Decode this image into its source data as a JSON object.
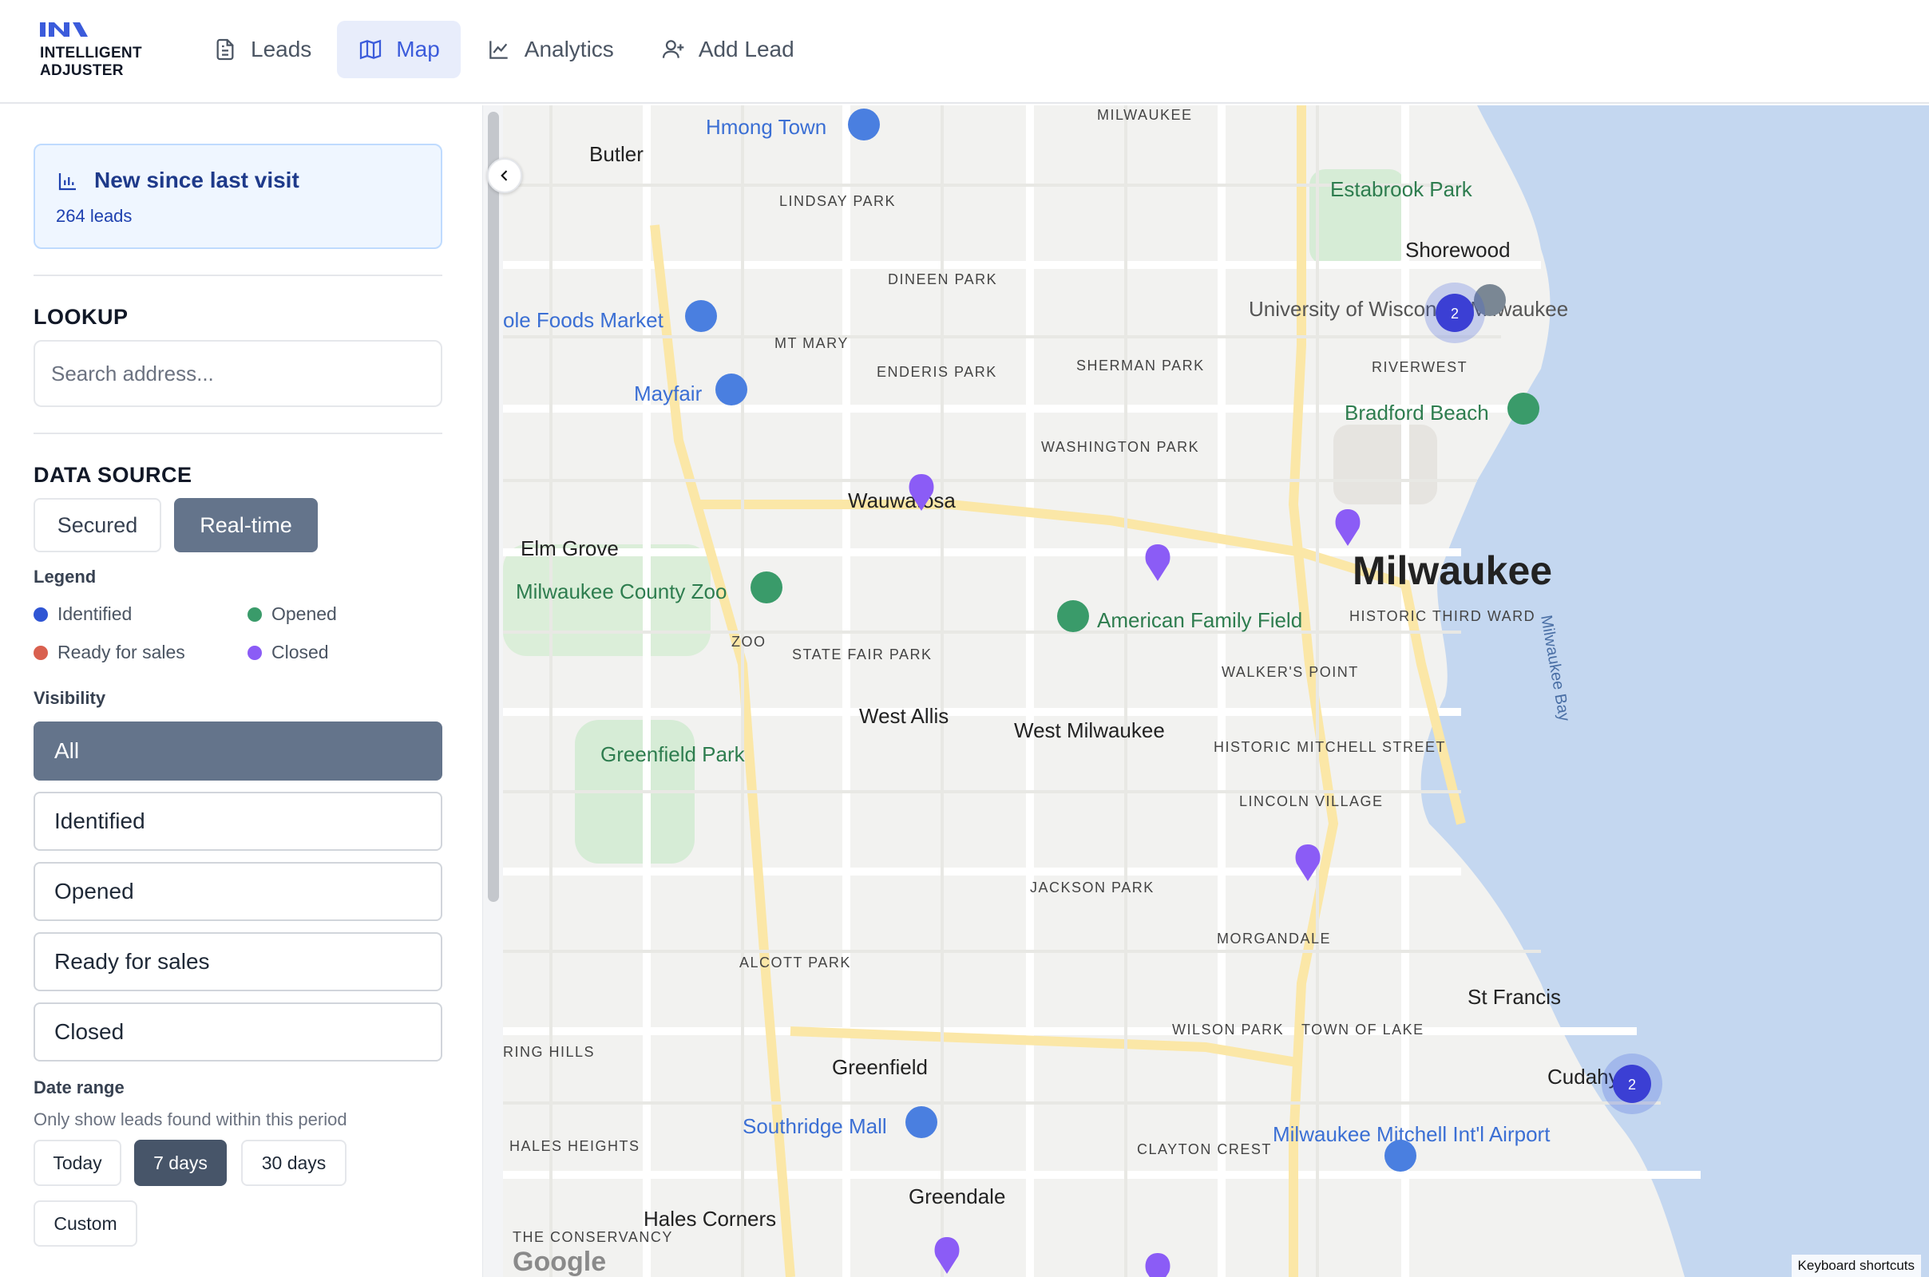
{
  "brand": {
    "line1": "INTELLIGENT",
    "line2": "ADJUSTER",
    "accent": "#3b5bdb"
  },
  "nav": [
    {
      "label": "Leads",
      "icon": "document-icon",
      "active": false
    },
    {
      "label": "Map",
      "icon": "map-icon",
      "active": true
    },
    {
      "label": "Analytics",
      "icon": "chart-icon",
      "active": false
    },
    {
      "label": "Add Lead",
      "icon": "user-plus-icon",
      "active": false
    }
  ],
  "new_card": {
    "title": "New since last visit",
    "subtitle": "264 leads"
  },
  "lookup": {
    "heading": "LOOKUP",
    "placeholder": "Search address..."
  },
  "data_source": {
    "heading": "DATA SOURCE",
    "options": [
      "Secured",
      "Real-time"
    ],
    "selected": "Real-time"
  },
  "legend": {
    "heading": "Legend",
    "items": [
      {
        "label": "Identified",
        "color": "#2f55d4"
      },
      {
        "label": "Opened",
        "color": "#3a9b6a"
      },
      {
        "label": "Ready for sales",
        "color": "#d9604f"
      },
      {
        "label": "Closed",
        "color": "#8b5cf6"
      }
    ]
  },
  "visibility": {
    "heading": "Visibility",
    "options": [
      "All",
      "Identified",
      "Opened",
      "Ready for sales",
      "Closed"
    ],
    "selected": "All"
  },
  "date_range": {
    "heading": "Date range",
    "helper": "Only show leads found within this period",
    "options": [
      "Today",
      "7 days",
      "30 days",
      "Custom"
    ],
    "selected": "7 days"
  },
  "map": {
    "city_label": "Milwaukee",
    "poi": [
      {
        "label": "Hmong Town",
        "kind": "shopping"
      },
      {
        "label": "ole Foods Market",
        "kind": "shopping"
      },
      {
        "label": "Mayfair",
        "kind": "shopping"
      },
      {
        "label": "Milwaukee County Zoo",
        "kind": "zoo"
      },
      {
        "label": "American Family Field",
        "kind": "stadium"
      },
      {
        "label": "Bradford Beach",
        "kind": "park"
      },
      {
        "label": "Southridge Mall",
        "kind": "shopping"
      },
      {
        "label": "Milwaukee Mitchell Int'l Airport",
        "kind": "airport"
      },
      {
        "label": "Estabrook Park",
        "kind": "park"
      },
      {
        "label": "Greenfield Park",
        "kind": "park"
      },
      {
        "label": "University of Wisconsin-Milwaukee",
        "kind": "university"
      }
    ],
    "places": [
      "Butler",
      "Shorewood",
      "Wauwatosa",
      "Elm Grove",
      "West Allis",
      "West Milwaukee",
      "St Francis",
      "Cudahy",
      "Greenfield",
      "Greendale",
      "Hales Corners"
    ],
    "neighborhoods": [
      "LINDSAY PARK",
      "DINEEN PARK",
      "MT MARY",
      "ENDERIS PARK",
      "SHERMAN PARK",
      "RIVERWEST",
      "WASHINGTON PARK",
      "HISTORIC THIRD WARD",
      "STATE FAIR PARK",
      "WALKER'S POINT",
      "HISTORIC MITCHELL STREET",
      "LINCOLN VILLAGE",
      "JACKSON PARK",
      "MORGANDALE",
      "ALCOTT PARK",
      "WILSON PARK",
      "TOWN OF LAKE",
      "CLAYTON CREST",
      "HALES HEIGHTS",
      "ZOO",
      "MILWAUKEE",
      "THE CONSERVANCY",
      "RING HILLS"
    ],
    "water": "Milwaukee Bay",
    "cluster_count": "2",
    "footer": "Keyboard shortcuts",
    "google": "Google"
  }
}
